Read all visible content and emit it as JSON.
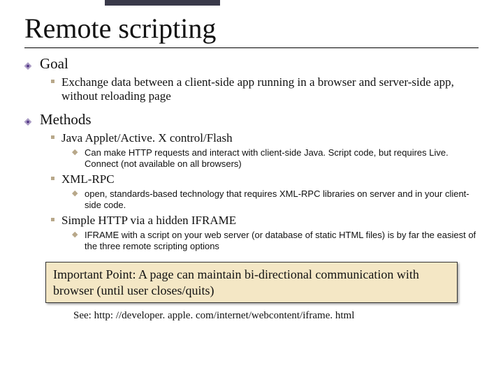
{
  "title": "Remote scripting",
  "sections": {
    "goal": {
      "label": "Goal",
      "item": "Exchange data between a client-side app running in a browser and server-side app,  without reloading page"
    },
    "methods": {
      "label": "Methods",
      "m1": {
        "label": "Java Applet/Active. X control/Flash",
        "detail": "Can make HTTP requests and interact with client-side Java. Script code, but requires Live. Connect (not available on all browsers)"
      },
      "m2": {
        "label": "XML-RPC",
        "detail": "open, standards-based technology that requires XML-RPC libraries on server and in your client-side code."
      },
      "m3": {
        "label": "Simple HTTP via a hidden IFRAME",
        "detail": "IFRAME with a script on your web server (or database of static HTML files) is by far the easiest of the three remote scripting options"
      }
    }
  },
  "callout": "Important Point: A page can maintain bi-directional communication with browser (until user closes/quits)",
  "reference": "See:  http: //developer. apple. com/internet/webcontent/iframe. html"
}
